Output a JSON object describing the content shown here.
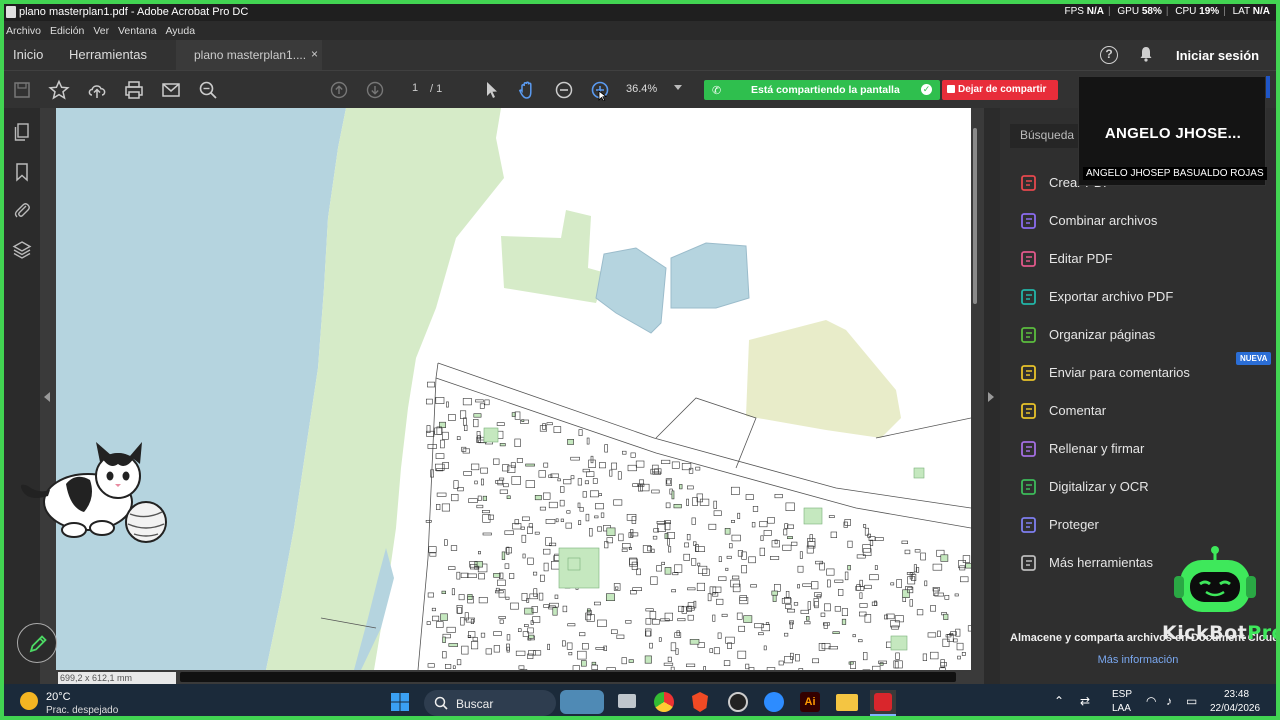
{
  "window": {
    "title": "plano masterplan1.pdf - Adobe Acrobat Pro DC"
  },
  "stats": {
    "fps_label": "FPS",
    "fps_value": "N/A",
    "gpu_label": "GPU",
    "gpu_value": "58%",
    "cpu_label": "CPU",
    "cpu_value": "19%",
    "lat_label": "LAT",
    "lat_value": "N/A"
  },
  "menu": [
    "Archivo",
    "Edición",
    "Ver",
    "Ventana",
    "Ayuda"
  ],
  "tabs": {
    "home": "Inicio",
    "tools": "Herramientas",
    "document": "plano masterplan1....",
    "close": "×",
    "help": "?",
    "signin": "Iniciar sesión"
  },
  "toolbar": {
    "page_current": "1",
    "page_total": "/ 1",
    "zoom": "36.4%"
  },
  "share": {
    "sharing_label": "Está compartiendo la pantalla",
    "stop_label": "Dejar de compartir"
  },
  "participant": {
    "display": "ANGELO  JHOSE...",
    "full_name": "ANGELO JHOSEP BASUALDO ROJAS"
  },
  "document": {
    "dimensions": "699,2 x 612,1 mm"
  },
  "tools_panel": {
    "search_placeholder": "Búsqueda",
    "items": [
      {
        "label": "Crear PDF",
        "icon": "create-pdf-icon",
        "color": "#e5484d"
      },
      {
        "label": "Combinar archivos",
        "icon": "combine-files-icon",
        "color": "#8b6cf0"
      },
      {
        "label": "Editar PDF",
        "icon": "edit-pdf-icon",
        "color": "#e0588a"
      },
      {
        "label": "Exportar archivo PDF",
        "icon": "export-pdf-icon",
        "color": "#22b5a8"
      },
      {
        "label": "Organizar páginas",
        "icon": "organize-pages-icon",
        "color": "#5bbd3e"
      },
      {
        "label": "Enviar para comentarios",
        "icon": "send-comments-icon",
        "color": "#e8c22a"
      },
      {
        "label": "Comentar",
        "icon": "comment-icon",
        "color": "#e8c22a"
      },
      {
        "label": "Rellenar y firmar",
        "icon": "fill-sign-icon",
        "color": "#a36ee0"
      },
      {
        "label": "Digitalizar y OCR",
        "icon": "scan-ocr-icon",
        "color": "#3dbb5a"
      },
      {
        "label": "Proteger",
        "icon": "protect-icon",
        "color": "#7f7ff0"
      },
      {
        "label": "Más herramientas",
        "icon": "more-tools-icon",
        "color": "#bbbbbb"
      }
    ],
    "new_badge": "NUEVA",
    "cloud_text": "Almacene y comparta archivos en Document Cloud",
    "more_info": "Más información"
  },
  "brand": {
    "kick": "KickBot",
    "pro": "Pro"
  },
  "taskbar": {
    "temperature": "20°C",
    "weather": "Prac. despejado",
    "search": "Buscar",
    "lang_top": "ESP",
    "lang_bottom": "LAA",
    "time": "23:48",
    "date": "22/04/2026"
  },
  "colors": {
    "accent_green": "#2fbf4e",
    "stop_red": "#e82d3a",
    "frame_green": "#42d452",
    "acrobat_red": "#d9262c"
  }
}
